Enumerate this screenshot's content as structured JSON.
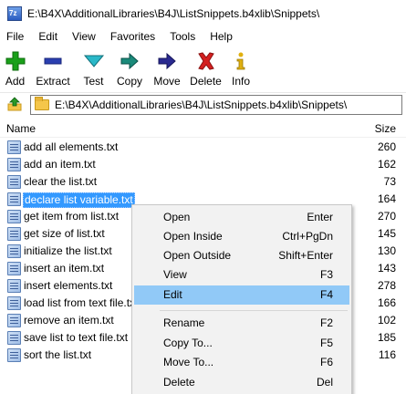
{
  "window": {
    "title": "E:\\B4X\\AdditionalLibraries\\B4J\\ListSnippets.b4xlib\\Snippets\\"
  },
  "menubar": [
    "File",
    "Edit",
    "View",
    "Favorites",
    "Tools",
    "Help"
  ],
  "toolbar": {
    "add": "Add",
    "extract": "Extract",
    "test": "Test",
    "copy": "Copy",
    "move": "Move",
    "delete": "Delete",
    "info": "Info"
  },
  "address": {
    "path": "E:\\B4X\\AdditionalLibraries\\B4J\\ListSnippets.b4xlib\\Snippets\\"
  },
  "columns": {
    "name": "Name",
    "size": "Size"
  },
  "files": [
    {
      "name": "add all elements.txt",
      "size": "260"
    },
    {
      "name": "add an item.txt",
      "size": "162"
    },
    {
      "name": "clear the list.txt",
      "size": "73"
    },
    {
      "name": "declare list variable.txt",
      "size": "164"
    },
    {
      "name": "get item from list.txt",
      "size": "270"
    },
    {
      "name": "get size of list.txt",
      "size": "145"
    },
    {
      "name": "initialize the list.txt",
      "size": "130"
    },
    {
      "name": "insert an item.txt",
      "size": "143"
    },
    {
      "name": "insert elements.txt",
      "size": "278"
    },
    {
      "name": "load list from text file.txt",
      "size": "166"
    },
    {
      "name": "remove an item.txt",
      "size": "102"
    },
    {
      "name": "save list to text file.txt",
      "size": "185"
    },
    {
      "name": "sort the list.txt",
      "size": "116"
    }
  ],
  "selected_file": "declare list variable.txt",
  "context_menu": {
    "open": {
      "label": "Open",
      "key": "Enter"
    },
    "open_inside": {
      "label": "Open Inside",
      "key": "Ctrl+PgDn"
    },
    "open_outside": {
      "label": "Open Outside",
      "key": "Shift+Enter"
    },
    "view": {
      "label": "View",
      "key": "F3"
    },
    "edit": {
      "label": "Edit",
      "key": "F4"
    },
    "rename": {
      "label": "Rename",
      "key": "F2"
    },
    "copy_to": {
      "label": "Copy To...",
      "key": "F5"
    },
    "move_to": {
      "label": "Move To...",
      "key": "F6"
    },
    "delete": {
      "label": "Delete",
      "key": "Del"
    }
  },
  "highlighted_menu_item": "Edit",
  "colors": {
    "selection": "#3399ff",
    "menu_highlight": "#91c9f7",
    "add_icon": "#1aa01a",
    "delete_icon": "#d42020"
  }
}
